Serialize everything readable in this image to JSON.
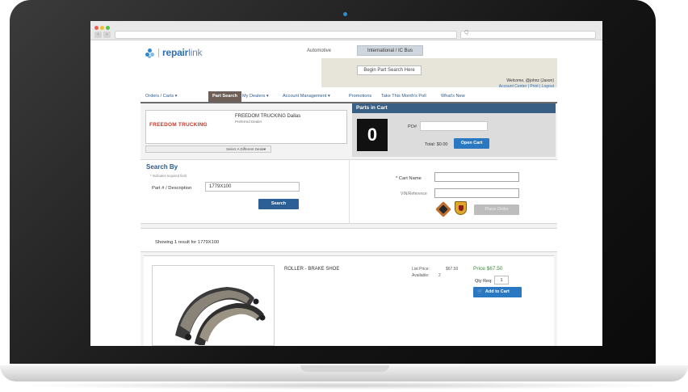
{
  "browser": {
    "search_placeholder": "Q"
  },
  "site": {
    "logo_text_bold": "repair",
    "logo_text_light": "link",
    "header": {
      "automotive_label": "Automotive",
      "tab_label": "International / IC Bus",
      "begin_search": "Begin Part Search Here",
      "welcome": "Welcome, @johnz (Jaxon)",
      "account_links": "Account Center  |  Print  |  Logout"
    },
    "nav": [
      {
        "label": "Orders / Carts ▾",
        "active": false
      },
      {
        "label": "Part Search",
        "active": true
      },
      {
        "label": "My Dealers ▾",
        "active": false
      },
      {
        "label": "Account Management ▾",
        "active": false
      },
      {
        "label": "Promotions",
        "active": false
      },
      {
        "label": "Take This Month's Poll",
        "active": false
      },
      {
        "label": "What's New",
        "active": false
      }
    ],
    "dealer": {
      "logo": "FREEDOM TRUCKING",
      "name": "FREEDOM TRUCKING Dallas",
      "sub": "Preferred Dealer",
      "select_label": "Select A Different Dealer"
    },
    "cart": {
      "header": "Parts in Cart",
      "count": "0",
      "po_label": "PO#",
      "total": "Total: $0.00",
      "open_cart": "Open Cart"
    },
    "search": {
      "title": "Search By",
      "hint": "* Indicates required field",
      "part_label": "Part # / Description",
      "part_value": "1779X100",
      "search_button": "Search",
      "cart_name_label": "* Cart Name",
      "vin_label": "VIN/Reference",
      "place_order": "Place Order"
    },
    "results": {
      "showing": "Showing 1 result for 1779X100",
      "product_name": "ROLLER - BRAKE SHOE",
      "list_price_label": "List Price:",
      "list_price_value": "$67.50",
      "available_label": "Available:",
      "available_value": "2",
      "price": "Price $67.50",
      "qty_label": "Qty Req:",
      "qty_value": "1",
      "add_to_cart": "Add to Cart"
    }
  },
  "colors": {
    "brand_blue": "#2d6fb7",
    "button_blue": "#2b78c2",
    "cart_header": "#3a5f85",
    "active_tab": "#6d5f57",
    "price_green": "#3b8d3b",
    "dealer_red": "#c0392b"
  },
  "icons": {
    "cart_icon": "shopping-cart"
  }
}
